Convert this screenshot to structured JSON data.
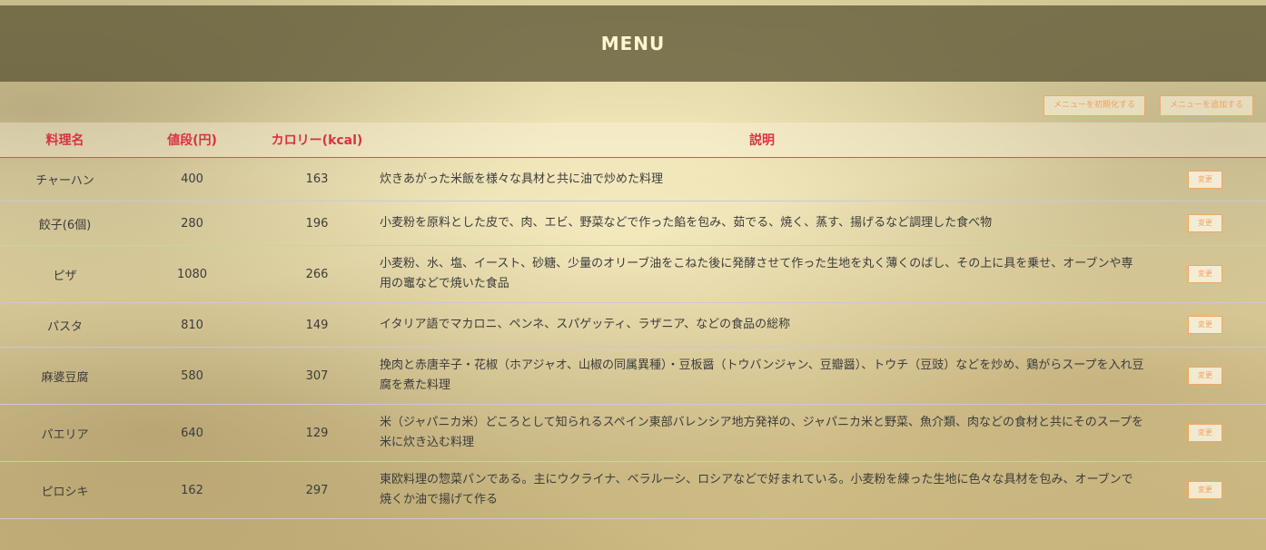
{
  "header": {
    "title": "MENU"
  },
  "actions": {
    "reset_label": "メニューを初期化する",
    "add_label": "メニューを追加する"
  },
  "table": {
    "columns": [
      "料理名",
      "値段(円)",
      "カロリー(kcal)",
      "説明"
    ],
    "edit_label": "変更",
    "rows": [
      {
        "name": "チャーハン",
        "price": "400",
        "calories": "163",
        "description": "炊きあがった米飯を様々な具材と共に油で炒めた料理"
      },
      {
        "name": "餃子(6個)",
        "price": "280",
        "calories": "196",
        "description": "小麦粉を原料とした皮で、肉、エビ、野菜などで作った餡を包み、茹でる、焼く、蒸す、揚げるなど調理した食べ物"
      },
      {
        "name": "ピザ",
        "price": "1080",
        "calories": "266",
        "description": "小麦粉、水、塩、イースト、砂糖、少量のオリーブ油をこねた後に発酵させて作った生地を丸く薄くのばし、その上に具を乗せ、オーブンや専用の竈などで焼いた食品"
      },
      {
        "name": "パスタ",
        "price": "810",
        "calories": "149",
        "description": "イタリア語でマカロニ、ペンネ、スパゲッティ、ラザニア、などの食品の総称"
      },
      {
        "name": "麻婆豆腐",
        "price": "580",
        "calories": "307",
        "description": "挽肉と赤唐辛子・花椒（ホアジャオ、山椒の同属異種）・豆板醤（トウバンジャン、豆瓣醤）、トウチ（豆豉）などを炒め、鶏がらスープを入れ豆腐を煮た料理"
      },
      {
        "name": "パエリア",
        "price": "640",
        "calories": "129",
        "description": "米（ジャパニカ米）どころとして知られるスペイン東部バレンシア地方発祥の、ジャパニカ米と野菜、魚介類、肉などの食材と共にそのスープを米に炊き込む料理"
      },
      {
        "name": "ピロシキ",
        "price": "162",
        "calories": "297",
        "description": "東欧料理の惣菜パンである。主にウクライナ、ベラルーシ、ロシアなどで好まれている。小麦粉を練った生地に色々な具材を包み、オーブンで焼くか油で揚げて作る"
      }
    ]
  }
}
